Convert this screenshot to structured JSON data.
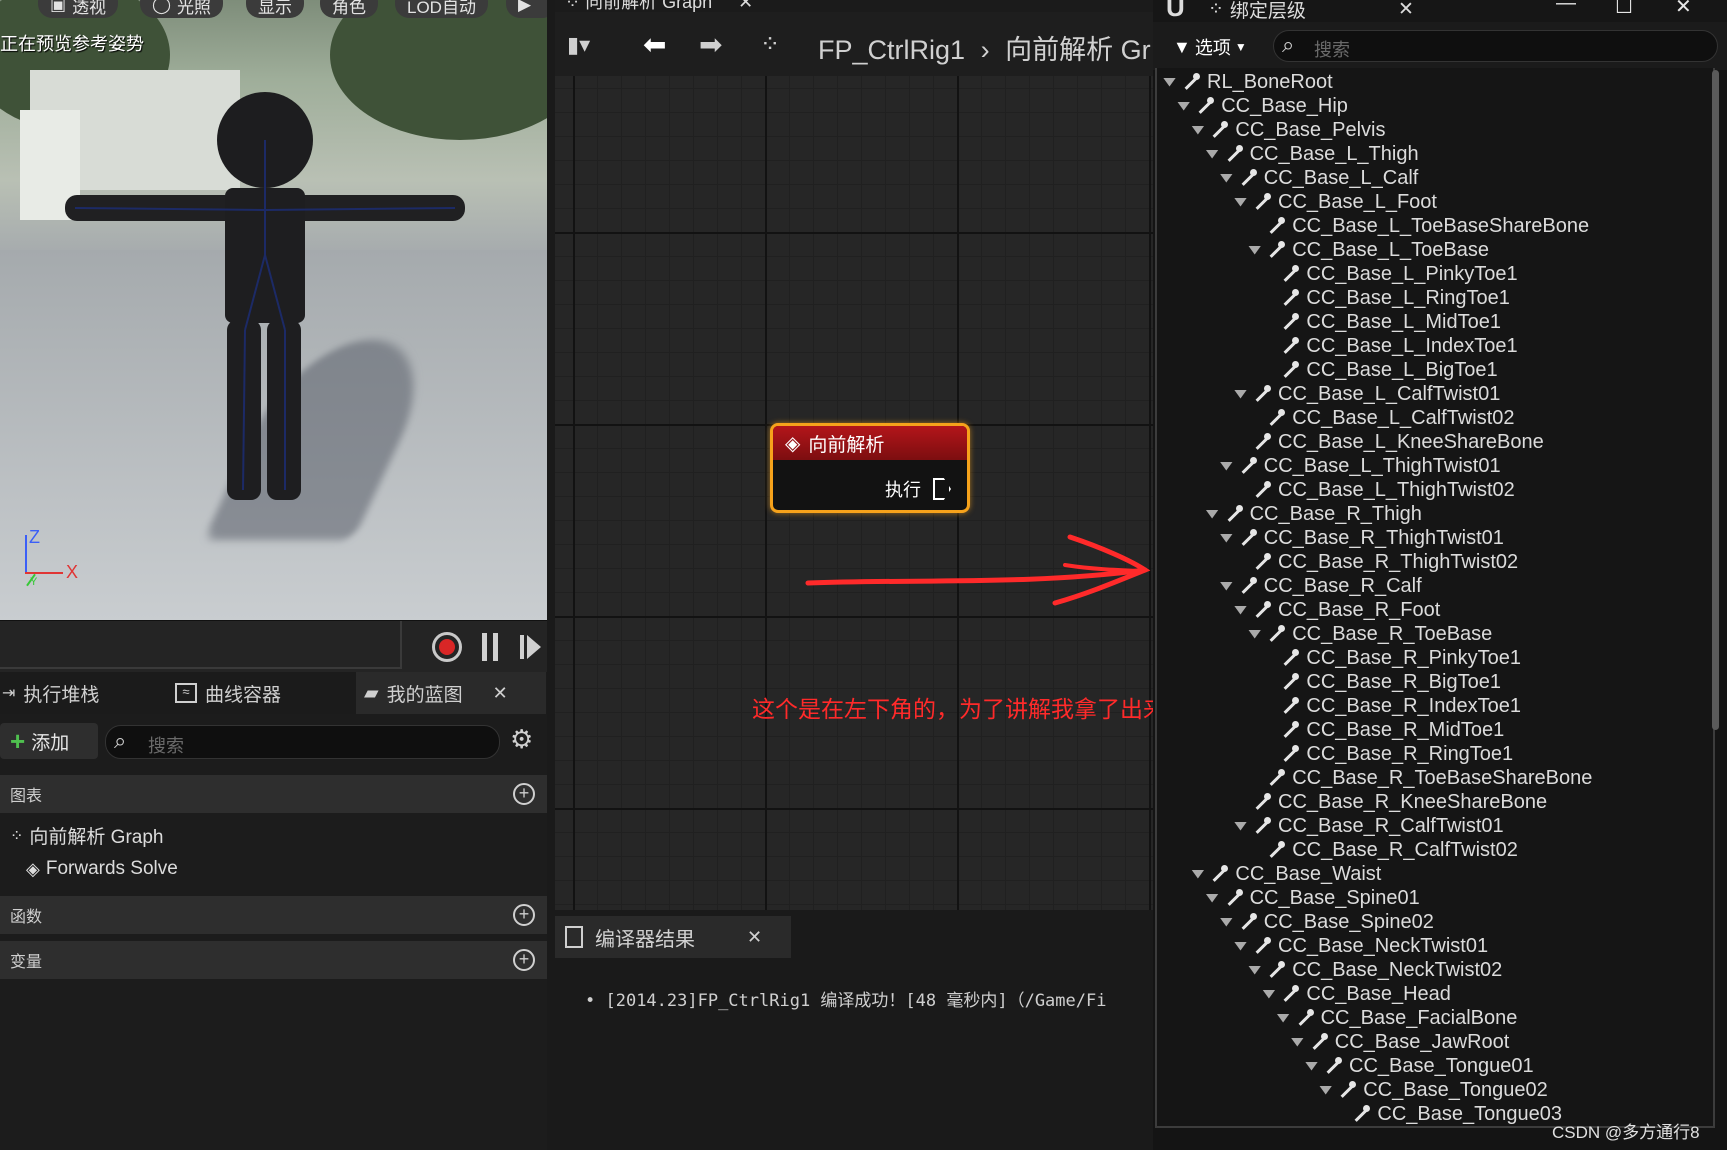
{
  "viewport": {
    "buttons": [
      "透视",
      "光照",
      "显示",
      "角色",
      "LOD自动"
    ],
    "preview_note": "正在预览参考姿势",
    "axes": {
      "z": "Z",
      "x": "X",
      "y": "Y"
    }
  },
  "blueprint_panel": {
    "tabs": [
      {
        "label": "执行堆栈"
      },
      {
        "label": "曲线容器"
      },
      {
        "label": "我的蓝图"
      }
    ],
    "add_label": "添加",
    "search_placeholder": "搜索",
    "sections": {
      "graphs": "图表",
      "functions": "函数",
      "variables": "变量"
    },
    "graph_items": [
      "向前解析 Graph",
      "Forwards Solve"
    ]
  },
  "graph": {
    "tab_title": "向前解析 Graph",
    "breadcrumb": {
      "root": "FP_CtrlRig1",
      "current": "向前解析 Gr"
    },
    "node": {
      "title": "向前解析",
      "pin": "执行"
    },
    "annotation": "这个是在左下角的，为了讲解我拿了出来"
  },
  "compiler": {
    "tab_title": "编译器结果",
    "message": "[2014.23]FP_CtrlRig1 编译成功！[48 毫秒内]（/Game/Fi"
  },
  "rig_hierarchy": {
    "title": "绑定层级",
    "options_label": "选项",
    "search_placeholder": "搜索",
    "bones": [
      {
        "name": "RL_BoneRoot",
        "depth": 0,
        "expanded": true
      },
      {
        "name": "CC_Base_Hip",
        "depth": 1,
        "expanded": true
      },
      {
        "name": "CC_Base_Pelvis",
        "depth": 2,
        "expanded": true
      },
      {
        "name": "CC_Base_L_Thigh",
        "depth": 3,
        "expanded": true
      },
      {
        "name": "CC_Base_L_Calf",
        "depth": 4,
        "expanded": true
      },
      {
        "name": "CC_Base_L_Foot",
        "depth": 5,
        "expanded": true
      },
      {
        "name": "CC_Base_L_ToeBaseShareBone",
        "depth": 6,
        "expanded": false
      },
      {
        "name": "CC_Base_L_ToeBase",
        "depth": 6,
        "expanded": true
      },
      {
        "name": "CC_Base_L_PinkyToe1",
        "depth": 7,
        "expanded": false
      },
      {
        "name": "CC_Base_L_RingToe1",
        "depth": 7,
        "expanded": false
      },
      {
        "name": "CC_Base_L_MidToe1",
        "depth": 7,
        "expanded": false
      },
      {
        "name": "CC_Base_L_IndexToe1",
        "depth": 7,
        "expanded": false
      },
      {
        "name": "CC_Base_L_BigToe1",
        "depth": 7,
        "expanded": false
      },
      {
        "name": "CC_Base_L_CalfTwist01",
        "depth": 5,
        "expanded": true
      },
      {
        "name": "CC_Base_L_CalfTwist02",
        "depth": 6,
        "expanded": false
      },
      {
        "name": "CC_Base_L_KneeShareBone",
        "depth": 5,
        "expanded": false
      },
      {
        "name": "CC_Base_L_ThighTwist01",
        "depth": 4,
        "expanded": true
      },
      {
        "name": "CC_Base_L_ThighTwist02",
        "depth": 5,
        "expanded": false
      },
      {
        "name": "CC_Base_R_Thigh",
        "depth": 3,
        "expanded": true
      },
      {
        "name": "CC_Base_R_ThighTwist01",
        "depth": 4,
        "expanded": true
      },
      {
        "name": "CC_Base_R_ThighTwist02",
        "depth": 5,
        "expanded": false
      },
      {
        "name": "CC_Base_R_Calf",
        "depth": 4,
        "expanded": true
      },
      {
        "name": "CC_Base_R_Foot",
        "depth": 5,
        "expanded": true
      },
      {
        "name": "CC_Base_R_ToeBase",
        "depth": 6,
        "expanded": true
      },
      {
        "name": "CC_Base_R_PinkyToe1",
        "depth": 7,
        "expanded": false
      },
      {
        "name": "CC_Base_R_BigToe1",
        "depth": 7,
        "expanded": false
      },
      {
        "name": "CC_Base_R_IndexToe1",
        "depth": 7,
        "expanded": false
      },
      {
        "name": "CC_Base_R_MidToe1",
        "depth": 7,
        "expanded": false
      },
      {
        "name": "CC_Base_R_RingToe1",
        "depth": 7,
        "expanded": false
      },
      {
        "name": "CC_Base_R_ToeBaseShareBone",
        "depth": 6,
        "expanded": false
      },
      {
        "name": "CC_Base_R_KneeShareBone",
        "depth": 5,
        "expanded": false
      },
      {
        "name": "CC_Base_R_CalfTwist01",
        "depth": 5,
        "expanded": true
      },
      {
        "name": "CC_Base_R_CalfTwist02",
        "depth": 6,
        "expanded": false
      },
      {
        "name": "CC_Base_Waist",
        "depth": 2,
        "expanded": true
      },
      {
        "name": "CC_Base_Spine01",
        "depth": 3,
        "expanded": true
      },
      {
        "name": "CC_Base_Spine02",
        "depth": 4,
        "expanded": true
      },
      {
        "name": "CC_Base_NeckTwist01",
        "depth": 5,
        "expanded": true
      },
      {
        "name": "CC_Base_NeckTwist02",
        "depth": 6,
        "expanded": true
      },
      {
        "name": "CC_Base_Head",
        "depth": 7,
        "expanded": true
      },
      {
        "name": "CC_Base_FacialBone",
        "depth": 8,
        "expanded": true
      },
      {
        "name": "CC_Base_JawRoot",
        "depth": 9,
        "expanded": true
      },
      {
        "name": "CC_Base_Tongue01",
        "depth": 10,
        "expanded": true
      },
      {
        "name": "CC_Base_Tongue02",
        "depth": 11,
        "expanded": true
      },
      {
        "name": "CC_Base_Tongue03",
        "depth": 12,
        "expanded": false
      }
    ]
  },
  "watermark": "CSDN @多方通行8",
  "colors": {
    "node_border": "#f6a21b",
    "node_header": "#b3151a",
    "annotation": "#ff2a2a"
  }
}
